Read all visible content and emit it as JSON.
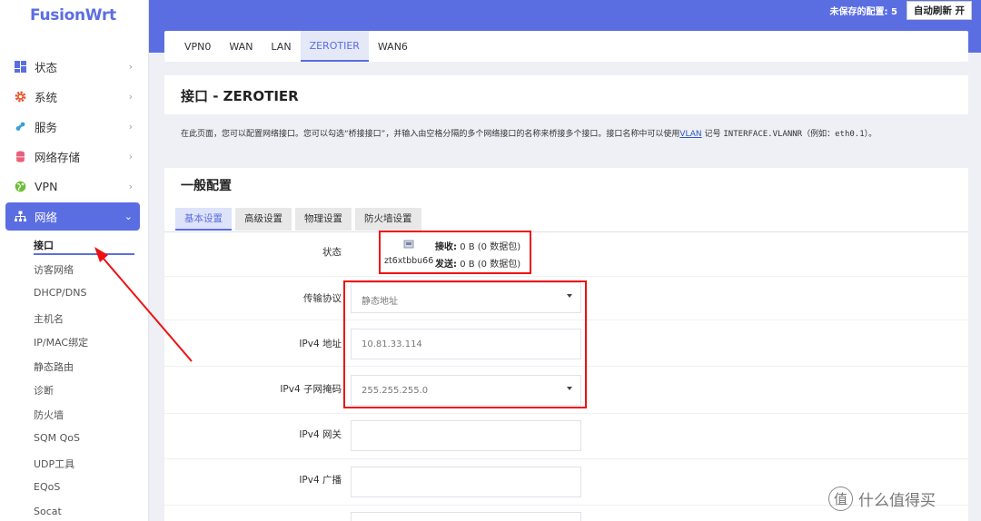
{
  "brand": "FusionWrt",
  "header": {
    "unsaved": "未保存的配置: 5",
    "autorefresh": "自动刷新 开"
  },
  "sidebar": {
    "items": [
      {
        "label": "状态",
        "icon": "dashboard-icon"
      },
      {
        "label": "系统",
        "icon": "gear-icon"
      },
      {
        "label": "服务",
        "icon": "puzzle-icon"
      },
      {
        "label": "网络存储",
        "icon": "database-icon"
      },
      {
        "label": "VPN",
        "icon": "globe-icon"
      },
      {
        "label": "网络",
        "icon": "network-icon",
        "expanded": true
      }
    ],
    "subitems": [
      "接口",
      "访客网络",
      "DHCP/DNS",
      "主机名",
      "IP/MAC绑定",
      "静态路由",
      "诊断",
      "防火墙",
      "SQM QoS",
      "UDP工具",
      "EQoS",
      "Socat"
    ]
  },
  "tabs": [
    "VPN0",
    "WAN",
    "LAN",
    "ZEROTIER",
    "WAN6"
  ],
  "active_tab": "ZEROTIER",
  "page_title": "接口 - ZEROTIER",
  "description": {
    "part1": "在此页面，您可以配置网络接口。您可以勾选“桥接接口”，并输入由空格分隔的多个网络接口的名称来桥接多个接口。接口名称中可以使用",
    "link": "VLAN",
    "part2": "记号",
    "code1": "INTERFACE.VLANNR",
    "part3": "（例如：",
    "code2": "eth0.1",
    "part4": "）。"
  },
  "section_title": "一般配置",
  "subtabs": [
    "基本设置",
    "高级设置",
    "物理设置",
    "防火墙设置"
  ],
  "status": {
    "label": "状态",
    "iface": "zt6xtbbu66",
    "rx_label": "接收:",
    "rx_value": "0 B (0 数据包)",
    "tx_label": "发送:",
    "tx_value": "0 B (0 数据包)"
  },
  "fields": {
    "protocol": {
      "label": "传输协议",
      "value": "静态地址"
    },
    "ipv4_addr": {
      "label": "IPv4 地址",
      "value": "10.81.33.114"
    },
    "ipv4_mask": {
      "label": "IPv4 子网掩码",
      "value": "255.255.255.0"
    },
    "ipv4_gw": {
      "label": "IPv4 网关",
      "value": ""
    },
    "ipv4_bcast": {
      "label": "IPv4 广播",
      "value": ""
    }
  },
  "watermark": "什么值得买",
  "watermark_glyph": "值"
}
